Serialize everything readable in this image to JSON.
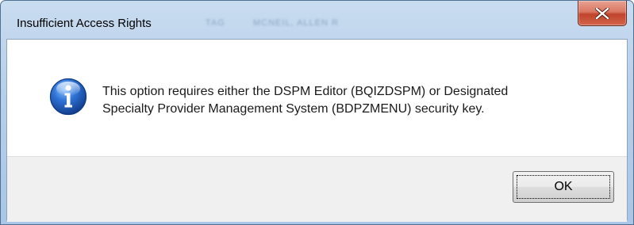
{
  "window": {
    "title": "Insufficient Access Rights",
    "background_text_1": "TAG",
    "background_text_2": "MCNEIL, ALLEN R"
  },
  "titlebar": {
    "close_icon": "close-x-icon"
  },
  "message": {
    "icon": "information-icon",
    "line1": "This option requires either the DSPM Editor (BQIZDSPM) or Designated",
    "line2": "Specialty Provider Management System (BDPZMENU) security key."
  },
  "buttons": {
    "ok_label": "OK"
  },
  "colors": {
    "titlebar": "#b7cfe9",
    "close_button": "#c74d33",
    "info_icon": "#1f63c6",
    "button_area": "#f0f0f0"
  }
}
